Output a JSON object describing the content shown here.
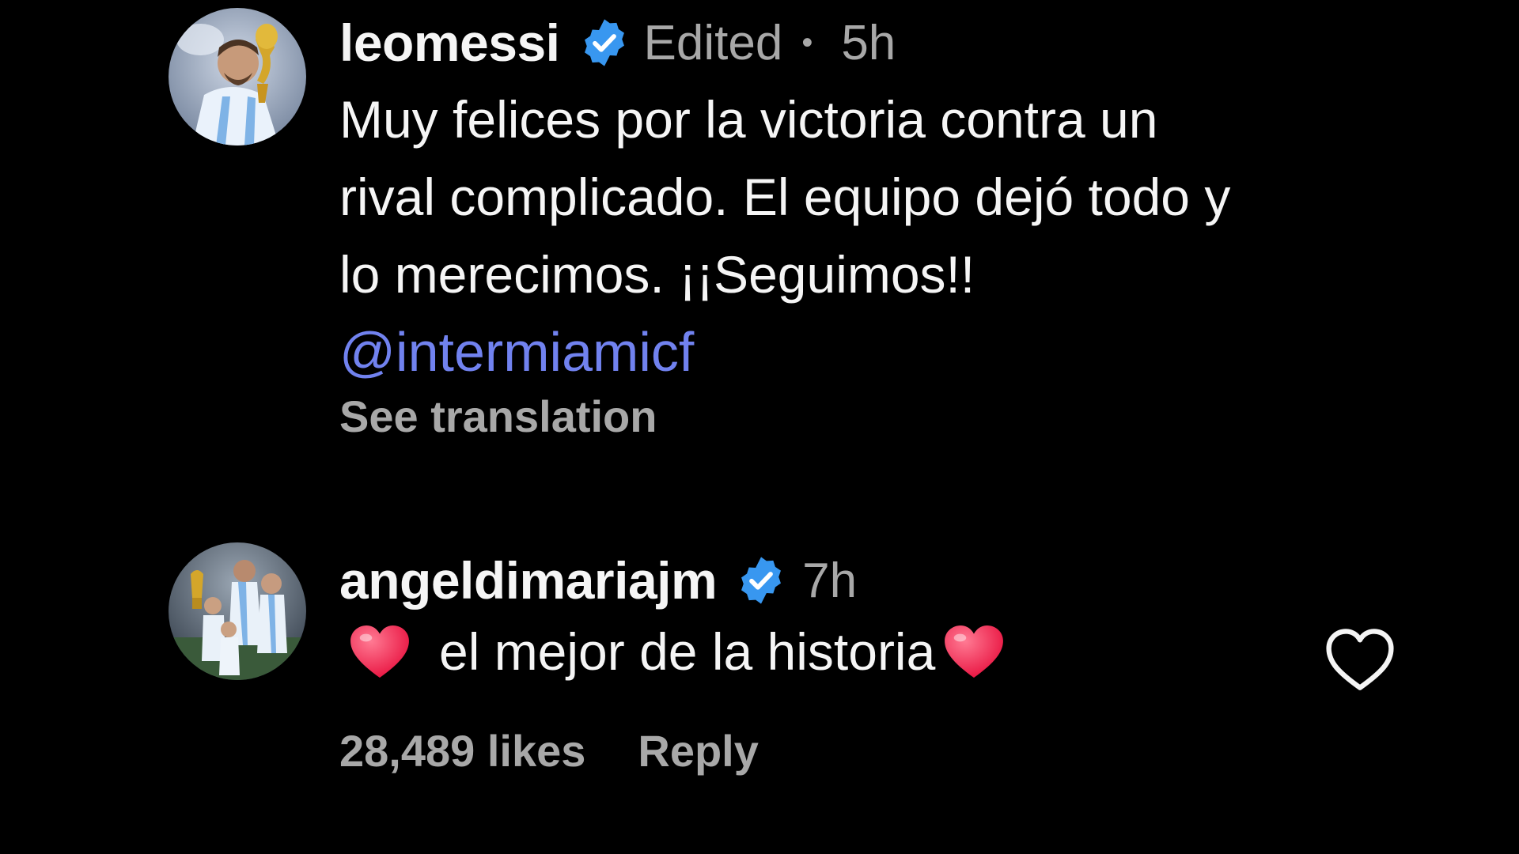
{
  "comments": [
    {
      "username": "leomessi",
      "verified": true,
      "edited_label": "Edited",
      "separator": "•",
      "time": "5h",
      "text_lines": [
        "Muy felices por la victoria contra un",
        "rival complicado. El equipo dejó todo y",
        "lo merecimos. ¡¡Seguimos!!"
      ],
      "mention": "@intermiamicf",
      "see_translation": "See translation",
      "avatar_icon": "avatar-trophy-photo"
    },
    {
      "username": "angeldimariajm",
      "verified": true,
      "time": "7h",
      "text": "el mejor de la historia",
      "emoji": "red-heart",
      "likes": "28,489 likes",
      "reply_label": "Reply",
      "like_icon": "heart-outline-icon",
      "avatar_icon": "avatar-family-photo"
    }
  ],
  "colors": {
    "background": "#000000",
    "primary_text": "#f5f5f5",
    "secondary_text": "#a8a8a8",
    "mention": "#7182ef",
    "verified_badge": "#3897f0",
    "heart_emoji": "#f0264c"
  }
}
